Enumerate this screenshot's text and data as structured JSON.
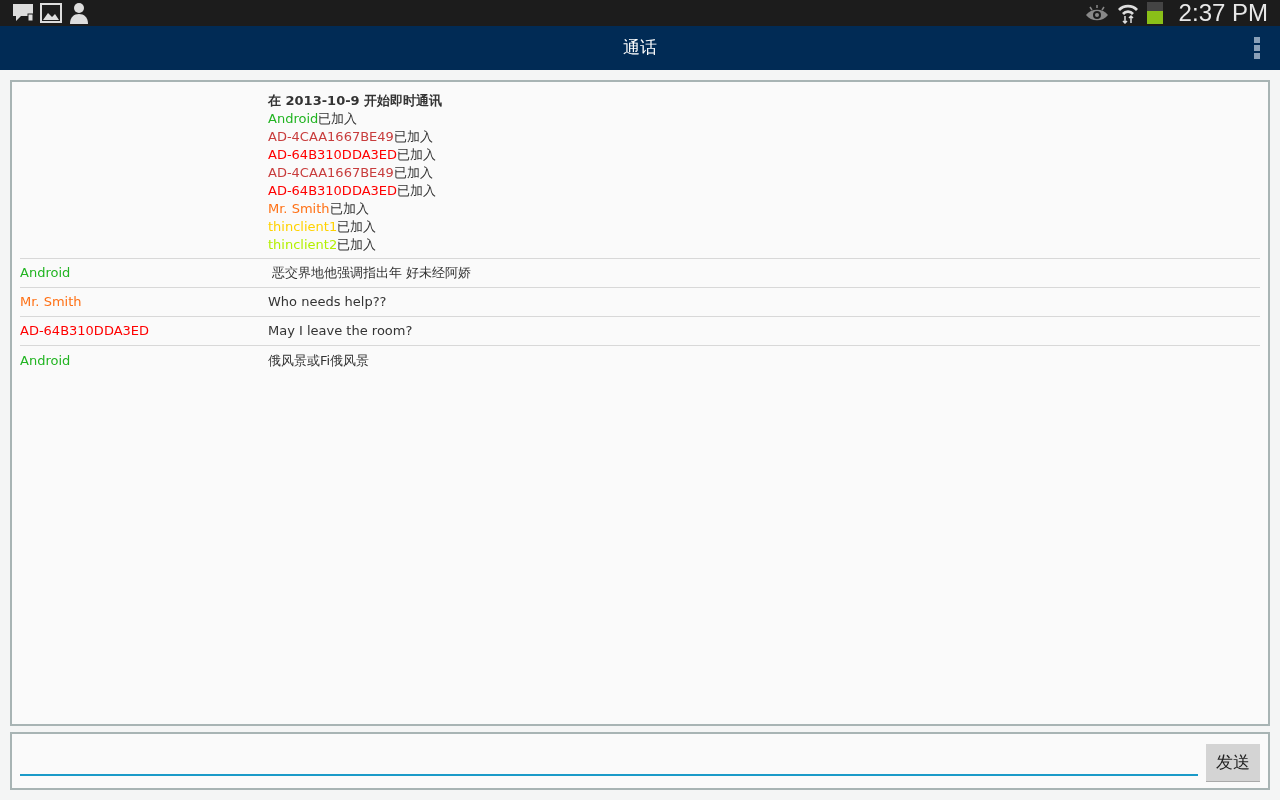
{
  "status_bar": {
    "time": "2:37 PM",
    "battery": {
      "level": 0.6
    }
  },
  "app_bar": {
    "title": "通话"
  },
  "log": {
    "header": "在 2013-10-9 开始即时通讯",
    "joins": [
      {
        "name": "Android",
        "color": "#22b422",
        "suffix": "已加入"
      },
      {
        "name": "AD-4CAA1667BE49",
        "color": "#c83c3c",
        "suffix": "已加入"
      },
      {
        "name": "AD-64B310DDA3ED",
        "color": "#ff0000",
        "suffix": "已加入"
      },
      {
        "name": "AD-4CAA1667BE49",
        "color": "#c83c3c",
        "suffix": "已加入"
      },
      {
        "name": "AD-64B310DDA3ED",
        "color": "#ff0000",
        "suffix": "已加入"
      },
      {
        "name": "Mr. Smith",
        "color": "#ff7014",
        "suffix": "已加入"
      },
      {
        "name": "thinclient1",
        "color": "#ffd200",
        "suffix": "已加入"
      },
      {
        "name": "thinclient2",
        "color": "#b4f000",
        "suffix": "已加入"
      }
    ]
  },
  "messages": [
    {
      "sender": "Android",
      "color": "#22b422",
      "text": " 恶交界地他强调指出年 好未经阿娇"
    },
    {
      "sender": "Mr. Smith",
      "color": "#ff7014",
      "text": "Who needs help??"
    },
    {
      "sender": "AD-64B310DDA3ED",
      "color": "#ff0000",
      "text": "May I leave the room?"
    },
    {
      "sender": "Android",
      "color": "#22b422",
      "text": "俄风景或Fi俄风景"
    }
  ],
  "composer": {
    "send_button": "发送"
  }
}
